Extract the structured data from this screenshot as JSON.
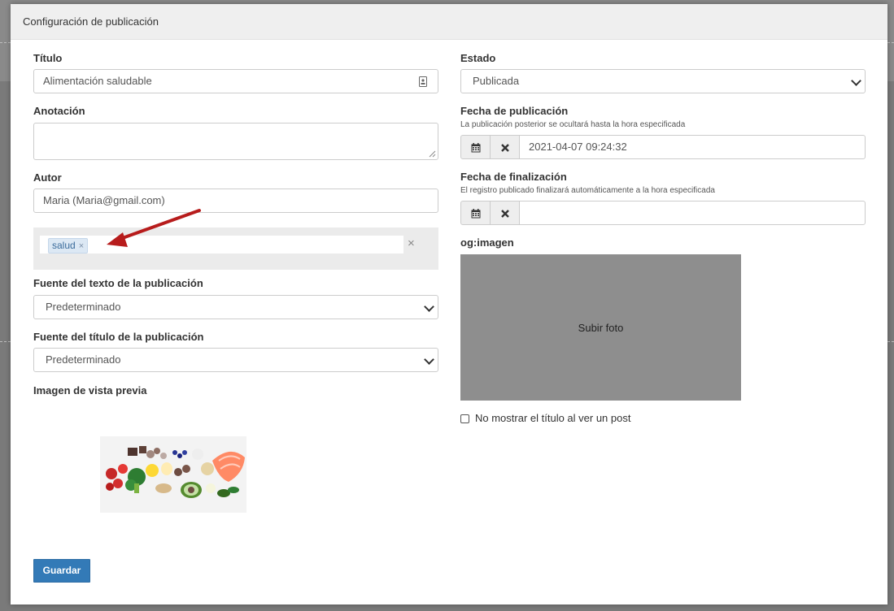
{
  "modal": {
    "title": "Configuración de publicación"
  },
  "form": {
    "title": {
      "label": "Título",
      "value": "Alimentación saludable"
    },
    "annotation": {
      "label": "Anotación",
      "value": ""
    },
    "author": {
      "label": "Autor",
      "value": "Maria (Maria@gmail.com)"
    },
    "tags": {
      "items": [
        "salud"
      ],
      "remove_glyph": "×",
      "clear_glyph": "×"
    },
    "text_font": {
      "label": "Fuente del texto de la publicación",
      "selected": "Predeterminado"
    },
    "title_font": {
      "label": "Fuente del título de la publicación",
      "selected": "Predeterminado"
    },
    "preview_image": {
      "label": "Imagen de vista previa"
    },
    "state": {
      "label": "Estado",
      "selected": "Publicada"
    },
    "publish_date": {
      "label": "Fecha de publicación",
      "help": "La publicación posterior se ocultará hasta la hora especificada",
      "value": "2021-04-07 09:24:32"
    },
    "end_date": {
      "label": "Fecha de finalización",
      "help": "El registro publicado finalizará automáticamente a la hora especificada",
      "value": ""
    },
    "og_image": {
      "label": "og:imagen",
      "upload_label": "Subir foto"
    },
    "hide_title": {
      "label": "No mostrar el título al ver un post",
      "checked": false
    },
    "save_label": "Guardar"
  },
  "icons": {
    "calendar": "calendar-icon",
    "clear": "times-icon",
    "contact_card": "contact-card-icon"
  },
  "colors": {
    "primary": "#337ab7",
    "arrow": "#b71c1c",
    "upload_bg": "#8e8e8e",
    "tag_bg": "#dce8f4"
  }
}
